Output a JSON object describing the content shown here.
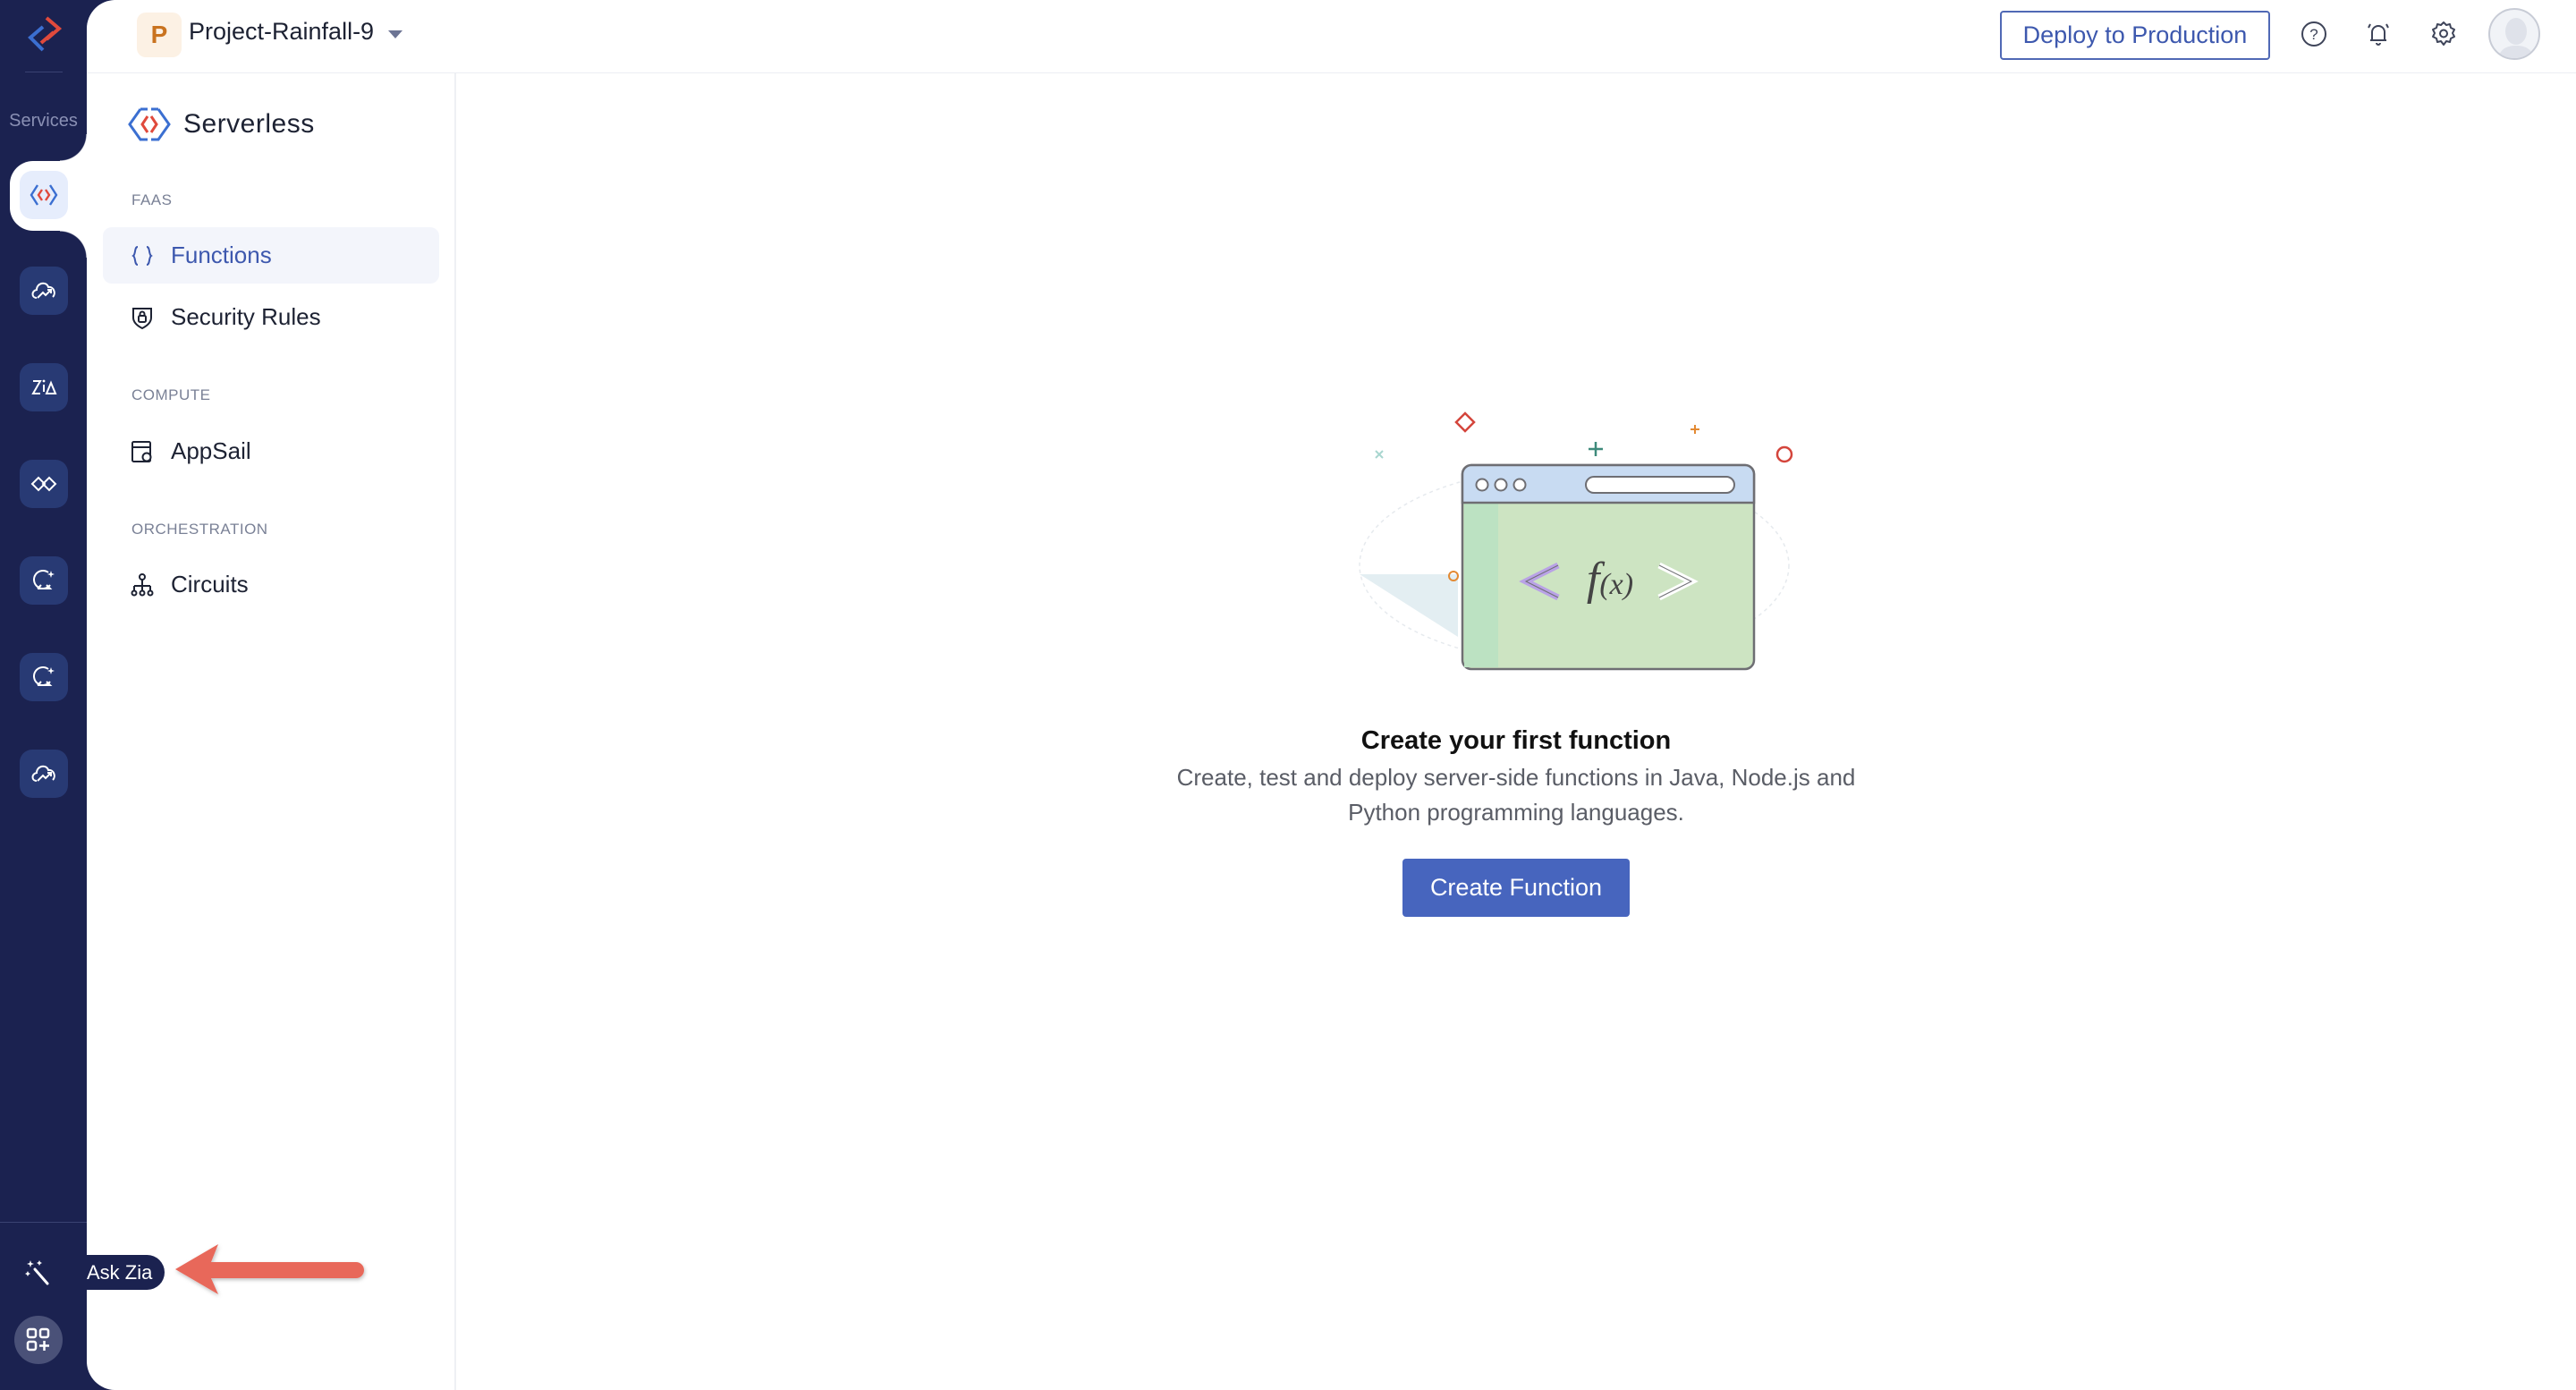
{
  "rail": {
    "services_label": "Services",
    "items": [
      {
        "icon": "serverless-icon",
        "active": true
      },
      {
        "icon": "cloud-growth-icon",
        "active": false
      },
      {
        "icon": "zia-icon",
        "active": false
      },
      {
        "icon": "integration-icon",
        "active": false
      },
      {
        "icon": "crystal-ball-icon",
        "active": false
      },
      {
        "icon": "crystal-ball-icon",
        "active": false
      },
      {
        "icon": "cloud-growth-icon",
        "active": false
      }
    ],
    "ask_zia_tooltip": "Ask Zia"
  },
  "header": {
    "project_initial": "P",
    "project_name": "Project-Rainfall-9",
    "deploy_label": "Deploy to Production"
  },
  "sidebar": {
    "service_title": "Serverless",
    "sections": [
      {
        "label": "FAAS",
        "items": [
          {
            "label": "Functions",
            "icon": "braces-icon",
            "active": true
          },
          {
            "label": "Security Rules",
            "icon": "shield-lock-icon",
            "active": false
          }
        ]
      },
      {
        "label": "COMPUTE",
        "items": [
          {
            "label": "AppSail",
            "icon": "appsail-icon",
            "active": false
          }
        ]
      },
      {
        "label": "ORCHESTRATION",
        "items": [
          {
            "label": "Circuits",
            "icon": "circuits-icon",
            "active": false
          }
        ]
      }
    ]
  },
  "empty_state": {
    "illustration_text": "f(x)",
    "title": "Create your first function",
    "description": "Create, test and deploy server-side functions in Java, Node.js and Python programming languages.",
    "button_label": "Create Function"
  },
  "colors": {
    "rail_bg": "#1b2250",
    "accent": "#4765be",
    "annotation_arrow": "#e8685a"
  }
}
